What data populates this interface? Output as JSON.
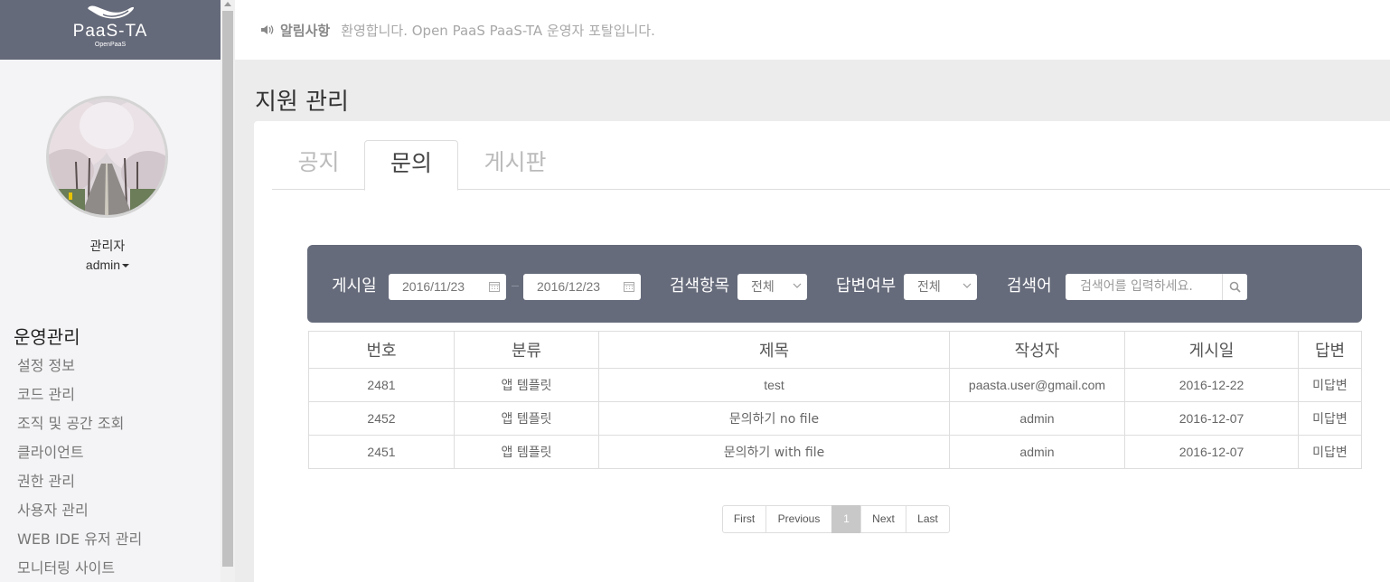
{
  "brand": {
    "name": "PaaS-TA",
    "sub": "OpenPaaS"
  },
  "user": {
    "role": "관리자",
    "name": "admin"
  },
  "menu": {
    "title": "운영관리",
    "items": [
      "설정 정보",
      "코드 관리",
      "조직 및 공간 조회",
      "클라이언트",
      "권한 관리",
      "사용자 관리",
      "WEB IDE 유저 관리",
      "모니터링 사이트"
    ]
  },
  "notice": {
    "label": "알림사항",
    "text": "환영합니다. Open PaaS PaaS-TA 운영자 포탈입니다."
  },
  "page": {
    "title": "지원 관리"
  },
  "tabs": [
    "공지",
    "문의",
    "게시판"
  ],
  "active_tab": "문의",
  "search": {
    "date_label": "게시일",
    "date_from": "2016/11/23",
    "date_to": "2016/12/23",
    "field_label": "검색항목",
    "field_value": "전체",
    "answer_label": "답변여부",
    "answer_value": "전체",
    "keyword_label": "검색어",
    "keyword_placeholder": "검색어를 입력하세요."
  },
  "table": {
    "headers": [
      "번호",
      "분류",
      "제목",
      "작성자",
      "게시일",
      "답변"
    ],
    "rows": [
      [
        "2481",
        "앱 템플릿",
        "test",
        "paasta.user@gmail.com",
        "2016-12-22",
        "미답변"
      ],
      [
        "2452",
        "앱 템플릿",
        "문의하기 no file",
        "admin",
        "2016-12-07",
        "미답변"
      ],
      [
        "2451",
        "앱 템플릿",
        "문의하기 with file",
        "admin",
        "2016-12-07",
        "미답변"
      ]
    ]
  },
  "pagination": {
    "first": "First",
    "previous": "Previous",
    "current": "1",
    "next": "Next",
    "last": "Last"
  },
  "colors": {
    "brand_bar": "#656a7a",
    "search_bar": "#666b7b",
    "page_bg": "#ececec"
  },
  "icons": [
    "speaker-icon",
    "calendar-icon",
    "chevron-down-icon",
    "search-icon"
  ]
}
